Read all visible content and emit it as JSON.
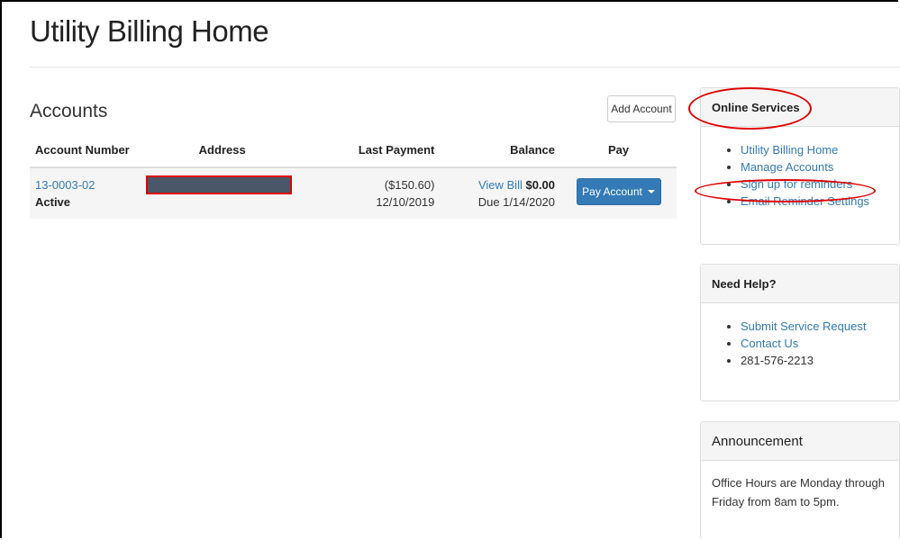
{
  "page": {
    "title": "Utility Billing Home"
  },
  "accounts": {
    "heading": "Accounts",
    "add_button": "Add Account",
    "columns": [
      "Account Number",
      "Address",
      "Last Payment",
      "Balance",
      "Pay"
    ],
    "rows": [
      {
        "account_number": "13-0003-02",
        "status": "Active",
        "last_payment_amount": "($150.60)",
        "last_payment_date": "12/10/2019",
        "view_bill_label": "View Bill",
        "balance": "$0.00",
        "due": "Due 1/14/2020",
        "pay_button": "Pay Account"
      }
    ]
  },
  "sidebar": {
    "online_services": {
      "heading": "Online Services",
      "items": [
        "Utility Billing Home",
        "Manage Accounts",
        "Sign up for reminders",
        "Email Reminder Settings"
      ]
    },
    "need_help": {
      "heading": "Need Help?",
      "items": [
        "Submit Service Request",
        "Contact Us",
        "281-576-2213"
      ]
    },
    "announcement": {
      "heading": "Announcement",
      "text": "Office Hours are Monday through Friday from 8am to 5pm."
    }
  },
  "colors": {
    "link": "#337ab7",
    "primary_button": "#337ab7",
    "highlight_annotation": "#e00000",
    "redaction": "#4a5768"
  }
}
